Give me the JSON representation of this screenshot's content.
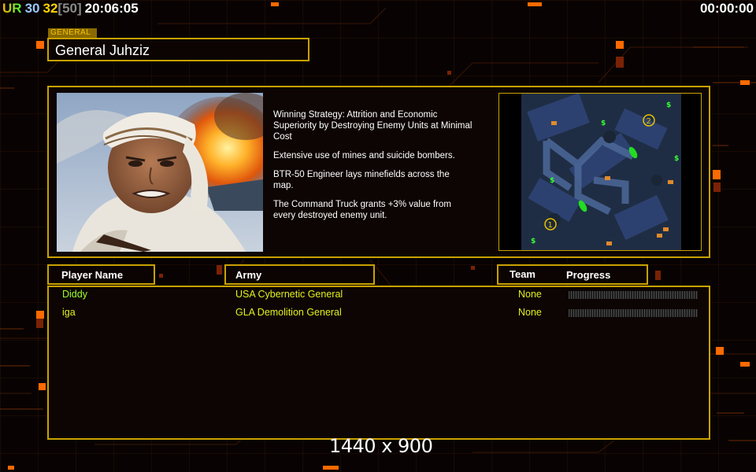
{
  "hud": {
    "ur_label": "UR",
    "fps": "30",
    "fps2": "32",
    "fps_limit": "[50]",
    "clock": "20:06:05",
    "timer": "00:00:00"
  },
  "general": {
    "tag": "GENERAL",
    "name": "General Juhziz",
    "description": [
      "Winning Strategy: Attrition and Economic\n Superiority by Destroying Enemy Units at Minimal\n Cost",
      "Extensive use of mines and suicide bombers.",
      "BTR-50 Engineer lays minefields across the\n map.",
      "The Command Truck grants +3% value from\n every destroyed enemy unit."
    ]
  },
  "minimap": {
    "start_positions": [
      "1",
      "2"
    ],
    "icons": [
      "supply-dollar-icon",
      "oil-derrick-icon",
      "supply-pile-icon"
    ]
  },
  "table": {
    "headers": {
      "player_name": "Player Name",
      "army": "Army",
      "team": "Team",
      "progress": "Progress"
    },
    "players": [
      {
        "name": "Diddy",
        "army": "USA Cybernetic General",
        "team": "None",
        "name_color": "#9cff2e",
        "army_color": "#e3f020",
        "progress": 0
      },
      {
        "name": "iga",
        "army": "GLA Demolition General",
        "team": "None",
        "name_color": "#e3f020",
        "army_color": "#e3f020",
        "progress": 0
      }
    ]
  },
  "resolution": "1440 x 900",
  "colors": {
    "panel_border": "#c9a100",
    "accent_orange": "#ff6a00",
    "team_color": "#e3f020"
  }
}
